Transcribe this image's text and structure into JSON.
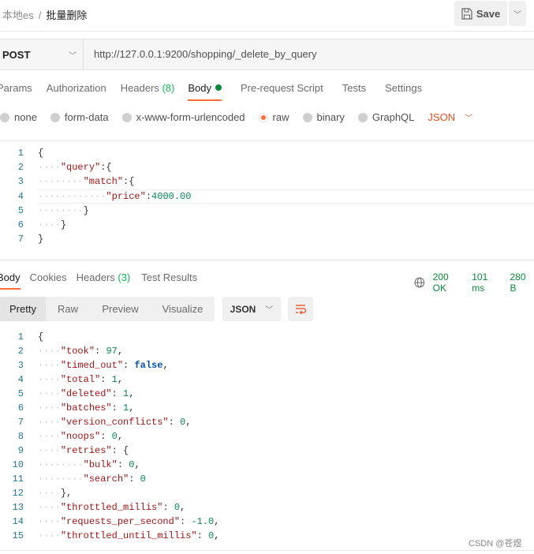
{
  "header": {
    "workspace": "本地es",
    "separator": "/",
    "request_name": "批量删除",
    "save_label": "Save"
  },
  "request": {
    "method": "POST",
    "url": "http://127.0.0.1:9200/shopping/_delete_by_query"
  },
  "tabs": [
    {
      "label": "Params"
    },
    {
      "label": "Authorization"
    },
    {
      "label": "Headers",
      "count": "(8)"
    },
    {
      "label": "Body",
      "active": true
    },
    {
      "label": "Pre-request Script"
    },
    {
      "label": "Tests"
    },
    {
      "label": "Settings"
    }
  ],
  "body_types": [
    {
      "label": "none"
    },
    {
      "label": "form-data"
    },
    {
      "label": "x-www-form-urlencoded"
    },
    {
      "label": "raw",
      "selected": true
    },
    {
      "label": "binary"
    },
    {
      "label": "GraphQL"
    }
  ],
  "body_format": "JSON",
  "request_body": [
    {
      "i": 0,
      "t": [
        [
          "p",
          "{"
        ]
      ]
    },
    {
      "i": 1,
      "t": [
        [
          "k",
          "\"query\""
        ],
        [
          "p",
          ":{"
        ]
      ]
    },
    {
      "i": 2,
      "t": [
        [
          "k",
          "\"match\""
        ],
        [
          "p",
          ":{"
        ]
      ]
    },
    {
      "i": 3,
      "t": [
        [
          "k",
          "\"price\""
        ],
        [
          "p",
          ":"
        ],
        [
          "n",
          "4000.00"
        ]
      ]
    },
    {
      "i": 2,
      "t": [
        [
          "p",
          "}"
        ]
      ]
    },
    {
      "i": 1,
      "t": [
        [
          "p",
          "}"
        ]
      ]
    },
    {
      "i": 0,
      "t": [
        [
          "p",
          "}"
        ]
      ]
    }
  ],
  "response": {
    "tabs": [
      {
        "label": "Body",
        "active": true
      },
      {
        "label": "Cookies"
      },
      {
        "label": "Headers",
        "count": "(3)"
      },
      {
        "label": "Test Results"
      }
    ],
    "status": "200 OK",
    "time": "101 ms",
    "size": "280 B",
    "views": [
      "Pretty",
      "Raw",
      "Preview",
      "Visualize"
    ],
    "format": "JSON",
    "body": [
      {
        "i": 0,
        "t": [
          [
            "p",
            "{"
          ]
        ]
      },
      {
        "i": 1,
        "t": [
          [
            "k",
            "\"took\""
          ],
          [
            "p",
            ": "
          ],
          [
            "n",
            "97"
          ],
          [
            "p",
            ","
          ]
        ]
      },
      {
        "i": 1,
        "t": [
          [
            "k",
            "\"timed_out\""
          ],
          [
            "p",
            ": "
          ],
          [
            "b",
            "false"
          ],
          [
            "p",
            ","
          ]
        ]
      },
      {
        "i": 1,
        "t": [
          [
            "k",
            "\"total\""
          ],
          [
            "p",
            ": "
          ],
          [
            "n",
            "1"
          ],
          [
            "p",
            ","
          ]
        ]
      },
      {
        "i": 1,
        "t": [
          [
            "k",
            "\"deleted\""
          ],
          [
            "p",
            ": "
          ],
          [
            "n",
            "1"
          ],
          [
            "p",
            ","
          ]
        ]
      },
      {
        "i": 1,
        "t": [
          [
            "k",
            "\"batches\""
          ],
          [
            "p",
            ": "
          ],
          [
            "n",
            "1"
          ],
          [
            "p",
            ","
          ]
        ]
      },
      {
        "i": 1,
        "t": [
          [
            "k",
            "\"version_conflicts\""
          ],
          [
            "p",
            ": "
          ],
          [
            "n",
            "0"
          ],
          [
            "p",
            ","
          ]
        ]
      },
      {
        "i": 1,
        "t": [
          [
            "k",
            "\"noops\""
          ],
          [
            "p",
            ": "
          ],
          [
            "n",
            "0"
          ],
          [
            "p",
            ","
          ]
        ]
      },
      {
        "i": 1,
        "t": [
          [
            "k",
            "\"retries\""
          ],
          [
            "p",
            ": {"
          ]
        ]
      },
      {
        "i": 2,
        "t": [
          [
            "k",
            "\"bulk\""
          ],
          [
            "p",
            ": "
          ],
          [
            "n",
            "0"
          ],
          [
            "p",
            ","
          ]
        ]
      },
      {
        "i": 2,
        "t": [
          [
            "k",
            "\"search\""
          ],
          [
            "p",
            ": "
          ],
          [
            "n",
            "0"
          ]
        ]
      },
      {
        "i": 1,
        "t": [
          [
            "p",
            "},"
          ]
        ]
      },
      {
        "i": 1,
        "t": [
          [
            "k",
            "\"throttled_millis\""
          ],
          [
            "p",
            ": "
          ],
          [
            "n",
            "0"
          ],
          [
            "p",
            ","
          ]
        ]
      },
      {
        "i": 1,
        "t": [
          [
            "k",
            "\"requests_per_second\""
          ],
          [
            "p",
            ": "
          ],
          [
            "n",
            "-1.0"
          ],
          [
            "p",
            ","
          ]
        ]
      },
      {
        "i": 1,
        "t": [
          [
            "k",
            "\"throttled_until_millis\""
          ],
          [
            "p",
            ": "
          ],
          [
            "n",
            "0"
          ],
          [
            "p",
            ","
          ]
        ]
      }
    ]
  },
  "watermark": "CSDN @苍煜",
  "colors": {
    "accent": "#ff6c37",
    "success": "#0a8a3a"
  }
}
